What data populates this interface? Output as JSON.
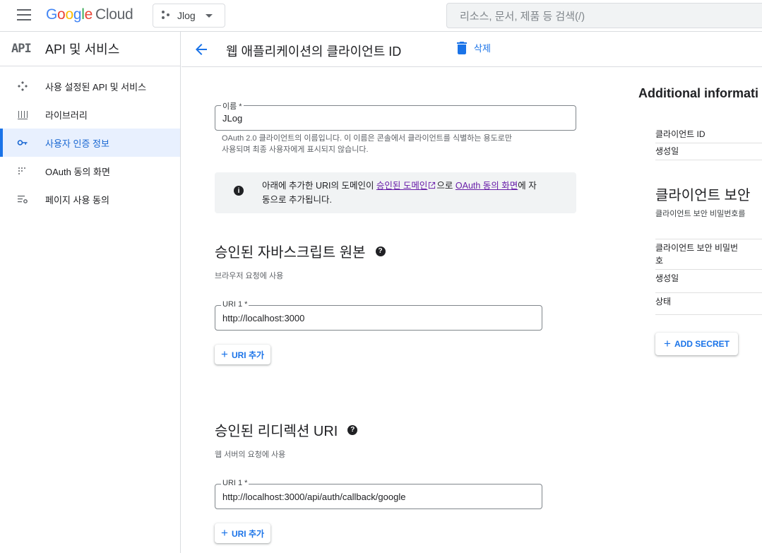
{
  "header": {
    "logo_google_parts": [
      "G",
      "o",
      "o",
      "g",
      "l",
      "e"
    ],
    "logo_cloud": "Cloud",
    "project": "Jlog",
    "search_placeholder": "리소스, 문서, 제품 등 검색(/)"
  },
  "sidebar": {
    "icon_text": "API",
    "title": "API 및 서비스",
    "items": [
      {
        "label": "사용 설정된 API 및 서비스",
        "icon": "enabled-apis-icon"
      },
      {
        "label": "라이브러리",
        "icon": "library-icon"
      },
      {
        "label": "사용자 인증 정보",
        "icon": "key-icon",
        "active": true
      },
      {
        "label": "OAuth 동의 화면",
        "icon": "oauth-consent-icon"
      },
      {
        "label": "페이지 사용 동의",
        "icon": "page-usage-icon"
      }
    ]
  },
  "page": {
    "title": "웹 애플리케이션의 클라이언트 ID",
    "delete_label": "삭제"
  },
  "form": {
    "name_label": "이름 *",
    "name_value": "JLog",
    "name_hint_1": "OAuth 2.0 클라이언트의 이름입니다. 이 이름은 콘솔에서 클라이언트를 식별하는 용도로만",
    "name_hint_2": "사용되며 최종 사용자에게 표시되지 않습니다.",
    "info_text_1": "아래에 추가한 URI의 도메인이 ",
    "info_link_1": "승인된 도메인",
    "info_text_2": "으로 ",
    "info_link_2": "OAuth 동의 화면",
    "info_text_3": "에 자",
    "info_text_4": "동으로 추가됩니다.",
    "js_origins_title": "승인된 자바스크립트 원본",
    "js_origins_sub": "브라우저 요청에 사용",
    "js_uri_label": "URI 1 *",
    "js_uri_value": "http://localhost:3000",
    "add_uri_label": "URI 추가",
    "redirect_title": "승인된 리디렉션 URI",
    "redirect_sub": "웹 서버의 요청에 사용",
    "redirect_uri_label": "URI 1 *",
    "redirect_uri_value": "http://localhost:3000/api/auth/callback/google",
    "add_uri_label_2": "URI 추가"
  },
  "right_panel": {
    "title": "Additional informati",
    "client_id_label": "클라이언트 ID",
    "created_label": "생성일",
    "secrets_title": "클라이언트 보안",
    "secrets_sub": "클라이언트 보안 비밀번호를",
    "secret_label_1": "클라이언트 보안 비밀번",
    "secret_label_2": "호",
    "secret_created_label": "생성일",
    "status_label": "상태",
    "add_secret_label": "ADD SECRET"
  },
  "colors": {
    "accent": "#1a73e8",
    "active_bg": "#e8f0fe",
    "link_visited": "#681da8"
  }
}
